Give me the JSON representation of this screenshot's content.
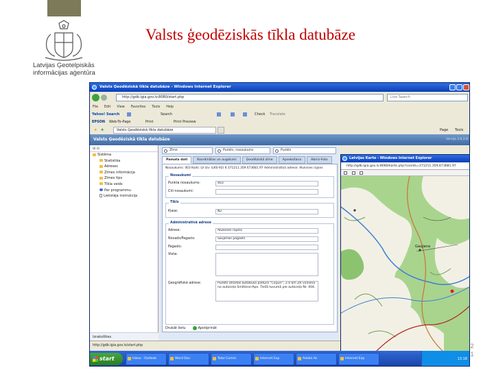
{
  "slide": {
    "title": "Valsts ģeodēziskās tīkla datubāze",
    "agency": "Latvijas Ģeotelpiskās informācijas aģentūra",
    "page_number": "2",
    "page_number_2": "1"
  },
  "browser": {
    "window_title": "Valsts Ģeodēziskā tīkla datubāze - Windows Internet Explorer",
    "address": "http://gdb.lgia.gov.lv:8080/start.php",
    "search_placeholder": "Live Search",
    "menu": [
      "File",
      "Edit",
      "View",
      "Favorites",
      "Tools",
      "Help"
    ],
    "yahoo_label": "Yahoo! Search",
    "yahoo_search": "Search",
    "check_label": "Check",
    "translate_label": "Translate",
    "epson_label": "EPSON",
    "web_to_page": "Web-To-Page",
    "print_label": "Print",
    "print_preview": "Print Preview",
    "tab_label": "Valsts Ģeodēziskā tīkla datubāze",
    "page_menu": "Page",
    "tools_menu": "Tools",
    "status_url": "http://gdb.lgia.gov.lv/start.php"
  },
  "app": {
    "header": "Valsts Ģeodēziskā tīkla datubāze",
    "version": "Versija 3.0.2.8",
    "sidebar_root": "Sistēma",
    "sidebar_items": [
      "Statistika",
      "Adreses",
      "Zīmes informācija",
      "Zīmes tips",
      "Tīkla veids",
      "Par programmu",
      "Lietotāja instrukcija"
    ],
    "sidebar_bottom": "Izrakstīties",
    "search": {
      "field1": "Zīme",
      "field2": "Punkts, nosaukums",
      "field3": "Punkts"
    },
    "tabs": [
      "Pamata dati",
      "Koordinātas un augstumi",
      "Ģeodēziskā zīme",
      "Apsekošana",
      "Abrisi-Foto"
    ],
    "info_line": "Nosaukums: 403 Kods: LV Izv: (LKS-92) 6 371211.359 673681.97 Administratīvā adrese: Aluksnes rajons",
    "sections": {
      "names": "Nosaukumi",
      "network": "Tīkls",
      "admin": "Administratīvā adrese"
    },
    "fields": {
      "point_name_label": "Punkta nosaukums:",
      "point_name": "403",
      "other_names_label": "Citi nosaukumi:",
      "other_names": "",
      "class_label": "Klase:",
      "class_value": "N2",
      "address_label": "Adrese:",
      "address_value": "Aluksnes rajons",
      "municipality_label": "Novads/Pagasts:",
      "municipality_value": "Šaujēnas pagasts",
      "town_label": "Pagasts:",
      "town_value": "",
      "place_label": "Vieta:",
      "place_value": "",
      "geo_label": "Ģeogrāfiskā adrese:",
      "geo_value": "Punkts atrodas autobusa pieturā \"Cirpuri\", 2.0 km ZR virzienā no autoceļa Smiltene-Ape. Tiešā tuvumā pie autoceļa Nr. 404."
    },
    "buttons": {
      "print": "Drukāt lietu",
      "save": "Apstiprināt"
    }
  },
  "popup": {
    "title": "Latvijas Karte - Windows Internet Explorer",
    "address": "http://gdb.lgia.gov.lv:8080/karte.php?coords=371211.359,673681.97"
  },
  "map": {
    "label": "Gaujiena"
  },
  "taskbar": {
    "start": "start",
    "tasks": [
      "Inbox - Outlook",
      "Word Doc",
      "Total Comm",
      "Internet Exp",
      "Adobe Ac",
      "Internet Exp"
    ],
    "clock": "13:18"
  }
}
